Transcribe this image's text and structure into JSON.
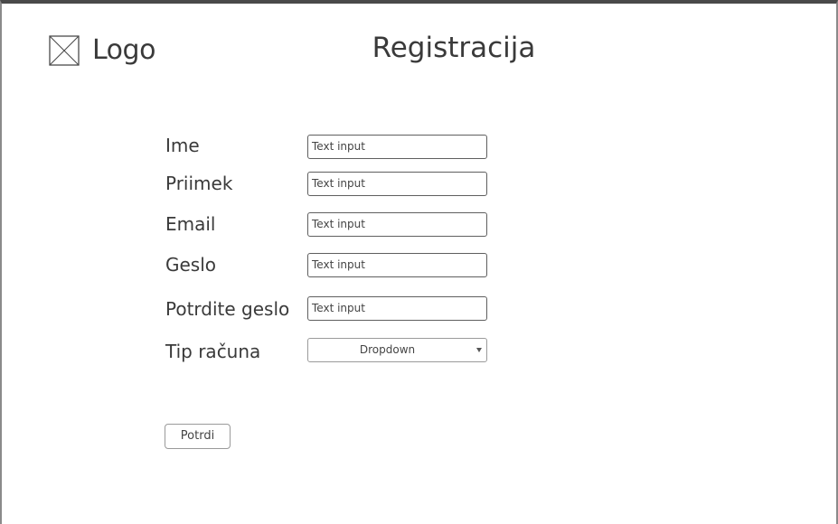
{
  "header": {
    "logo_icon": "image-placeholder-icon",
    "logo_text": "Logo",
    "title": "Registracija"
  },
  "form": {
    "fields": [
      {
        "label": "Ime",
        "value": "Text input"
      },
      {
        "label": "Priimek",
        "value": "Text input"
      },
      {
        "label": "Email",
        "value": "Text input"
      },
      {
        "label": "Geslo",
        "value": "Text input"
      },
      {
        "label": "Potrdite geslo",
        "value": "Text input"
      }
    ],
    "account_type": {
      "label": "Tip računa",
      "selected": "Dropdown",
      "icon": "caret-down-icon"
    },
    "submit_label": "Potrdi"
  }
}
